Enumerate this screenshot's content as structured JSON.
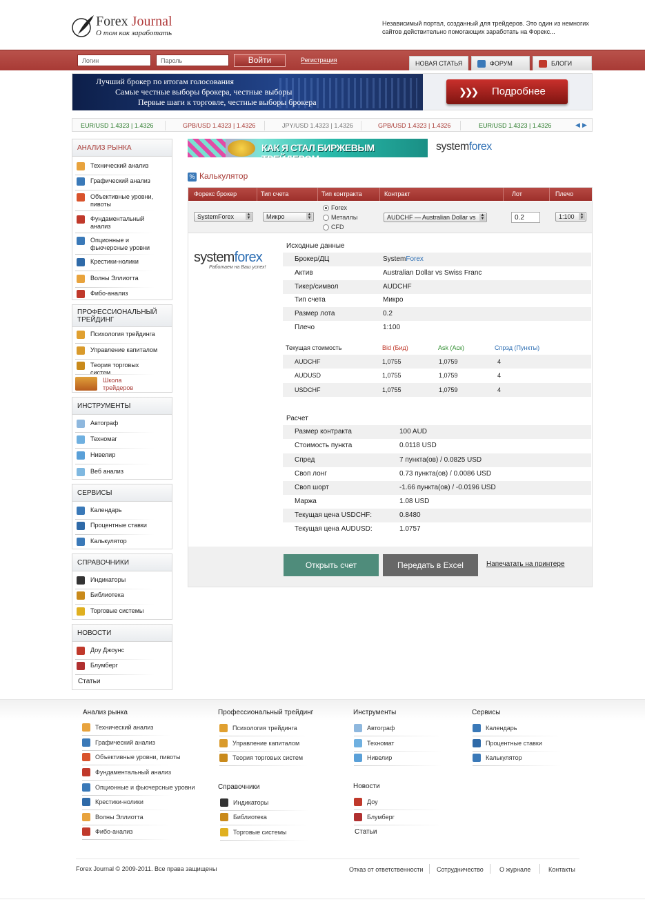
{
  "header": {
    "logo_title_a": "Forex",
    "logo_title_b": "Journal",
    "logo_subtitle": "О том как заработать",
    "tagline": "Независимый портал, созданный для трейдеров. Это один из немногих сайтов действительно помогающих заработать на Форекс..."
  },
  "login": {
    "login_placeholder": "Логин",
    "password_placeholder": "Пароль",
    "button": "Войти",
    "register": "Регистрация"
  },
  "tabs": [
    {
      "label": "НОВАЯ СТАТЬЯ"
    },
    {
      "label": "ФОРУМ"
    },
    {
      "label": "БЛОГИ"
    }
  ],
  "banner": {
    "line1": "Лучший брокер по итогам голосования",
    "line2": "Самые честные выборы брокера, честные выборы",
    "line3": "Первые шаги к торговле, честные выборы брокера",
    "button": "Подробнее"
  },
  "ticker": [
    {
      "text": "EUR/USD 1.4323 | 1.4326",
      "color": "#2a7a2a"
    },
    {
      "text": "GPB/USD 1.4323 | 1.4326",
      "color": "#a83a35"
    },
    {
      "text": "JPY/USD 1.4323 | 1.4326",
      "color": "#777777"
    },
    {
      "text": "GPB/USD 1.4323 | 1.4326",
      "color": "#a83a35"
    },
    {
      "text": "EUR/USD 1.4323 | 1.4326",
      "color": "#2a7a2a"
    }
  ],
  "sidebar": {
    "market": {
      "title": "АНАЛИЗ РЫНКА",
      "items": [
        "Технический анализ",
        "Графический анализ",
        "Объективные уровни, пивоты",
        "Фундаментальный анализ",
        "Опционные и фьючерсные уровни",
        "Крестики-нолики",
        "Волны Эллиотта",
        "Фибо-анализ"
      ]
    },
    "pro": {
      "title": "ПРОФЕССИОНАЛЬНЫЙ ТРЕЙДИНГ",
      "items": [
        "Психология трейдинга",
        "Управление капиталом",
        "Теория торговых систем"
      ],
      "school": "Школа трейдеров"
    },
    "tools": {
      "title": "ИНСТРУМЕНТЫ",
      "items": [
        "Автограф",
        "Техномаг",
        "Нивелир",
        "Веб анализ"
      ]
    },
    "services": {
      "title": "СЕРВИСЫ",
      "items": [
        "Календарь",
        "Процентные ставки",
        "Калькулятор"
      ]
    },
    "refs": {
      "title": "СПРАВОЧНИКИ",
      "items": [
        "Индикаторы",
        "Библиотека",
        "Торговые системы"
      ]
    },
    "news": {
      "title": "НОВОСТИ",
      "items": [
        "Доу Джоунс",
        "Блумберг"
      ],
      "articles": "Статьи"
    }
  },
  "ad": {
    "text": "КАК Я СТАЛ БИРЖЕВЫМ ТРЕЙДЕРОМ",
    "brand_a": "system",
    "brand_b": "forex"
  },
  "calc": {
    "title": "Калькулятор",
    "headers": [
      "Форекс брокер",
      "Тип счета",
      "Тип контракта",
      "Контракт",
      "Лот",
      "Плечо"
    ],
    "broker": "SystemForex",
    "account": "Микро",
    "contract_types": [
      "Forex",
      "Металлы",
      "CFD"
    ],
    "contract": "AUDCHF — Australian Dollar vs",
    "lot": "0.2",
    "leverage": "1:100",
    "logo_a": "system",
    "logo_b": "forex",
    "logo_slogan": "Работаем на Ваш успех!",
    "source_title": "Исходные данные",
    "source": [
      {
        "k": "Брокер/ДЦ",
        "v": "System",
        "v_hl": "Forex"
      },
      {
        "k": "Актив",
        "v": "Australian Dollar vs Swiss Franc"
      },
      {
        "k": "Тикер/символ",
        "v": "AUDCHF"
      },
      {
        "k": "Тип счета",
        "v": "Микро"
      },
      {
        "k": "Размер лота",
        "v": "0.2"
      },
      {
        "k": "Плечо",
        "v": "1:100"
      }
    ],
    "price_headers": [
      "Текущая стоимость",
      "Bid (Бид)",
      "Ask (Аск)",
      "Спрэд (Пункты)"
    ],
    "prices": [
      [
        "AUDCHF",
        "1,0755",
        "1,0759",
        "4"
      ],
      [
        "AUDUSD",
        "1,0755",
        "1,0759",
        "4"
      ],
      [
        "USDCHF",
        "1,0755",
        "1,0759",
        "4"
      ]
    ],
    "calc_title": "Расчет",
    "results": [
      {
        "k": "Размер контракта",
        "v": "100 AUD"
      },
      {
        "k": "Стоимость пункта",
        "v": "0.0118 USD"
      },
      {
        "k": "Спред",
        "v": "7 пункта(ов) / 0.0825 USD"
      },
      {
        "k": "Своп лонг",
        "v": "0.73 пункта(ов) / 0.0086 USD"
      },
      {
        "k": "Своп шорт",
        "v": "-1.66 пункта(ов) / -0.0196 USD"
      },
      {
        "k": "Маржа",
        "v": "1.08 USD"
      },
      {
        "k": "Текущая цена USDCHF:",
        "v": "0.8480"
      },
      {
        "k": "Текущая цена AUDUSD:",
        "v": "1.0757"
      }
    ],
    "btn_open": "Открыть счет",
    "btn_excel": "Передать в Excel",
    "btn_print": "Напечатать на принтере"
  },
  "footer": {
    "market": {
      "title": "Анализ рынка",
      "items": [
        "Технический анализ",
        "Графический анализ",
        "Объективные уровни, пивоты",
        "Фундаментальный анализ",
        "Опционные и фьючерсные уровни",
        "Крестики-нолики",
        "Волны Эллиотта",
        "Фибо-анализ"
      ]
    },
    "pro": {
      "title": "Профессиональный трейдинг",
      "items": [
        "Психология трейдинга",
        "Управление капиталом",
        "Теория торговых систем"
      ]
    },
    "refs": {
      "title": "Справочники",
      "items": [
        "Индикаторы",
        "Библиотека",
        "Торговые системы"
      ]
    },
    "tools": {
      "title": "Инструменты",
      "items": [
        "Автограф",
        "Техномат",
        "Нивелир"
      ]
    },
    "news": {
      "title": "Новости",
      "items": [
        "Доу",
        "Блумберг"
      ],
      "articles": "Статьи"
    },
    "services": {
      "title": "Сервисы",
      "items": [
        "Календарь",
        "Процентные ставки",
        "Калькулятор"
      ]
    },
    "copyright": "Forex Journal © 2009-2011. Все права защищены",
    "links": [
      "Отказ от ответственности",
      "Сотрудничество",
      "О журнале",
      "Контакты"
    ]
  }
}
